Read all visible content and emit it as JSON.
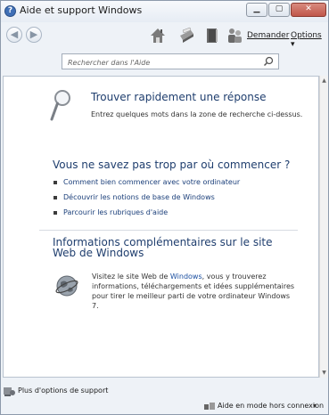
{
  "window": {
    "title": "Aide et support Windows"
  },
  "toolbar": {
    "ask_label": "Demander",
    "options_label": "Options"
  },
  "search": {
    "placeholder": "Rechercher dans l'Aide"
  },
  "quickfind": {
    "heading": "Trouver rapidement une réponse",
    "description": "Entrez quelques mots dans la zone de recherche ci-dessus."
  },
  "getting_started": {
    "heading": "Vous ne savez pas trop par où commencer ?",
    "links": [
      "Comment bien commencer avec votre ordinateur",
      "Découvrir les notions de base de Windows",
      "Parcourir les rubriques d'aide"
    ]
  },
  "more_info": {
    "heading": "Informations complémentaires sur le site Web de Windows",
    "text_before": "Visitez le site Web de ",
    "link": "Windows",
    "text_after": ", vous y trouverez informations, téléchargements et idées supplémentaires pour tirer le meilleur parti de votre ordinateur Windows 7."
  },
  "footer": {
    "support_label": "Plus d'options de support",
    "mode_label": "Aide en mode hors connexion"
  },
  "colors": {
    "heading": "#1f3e6e",
    "link": "#1b4fa0",
    "close_button": "#c0564a"
  }
}
